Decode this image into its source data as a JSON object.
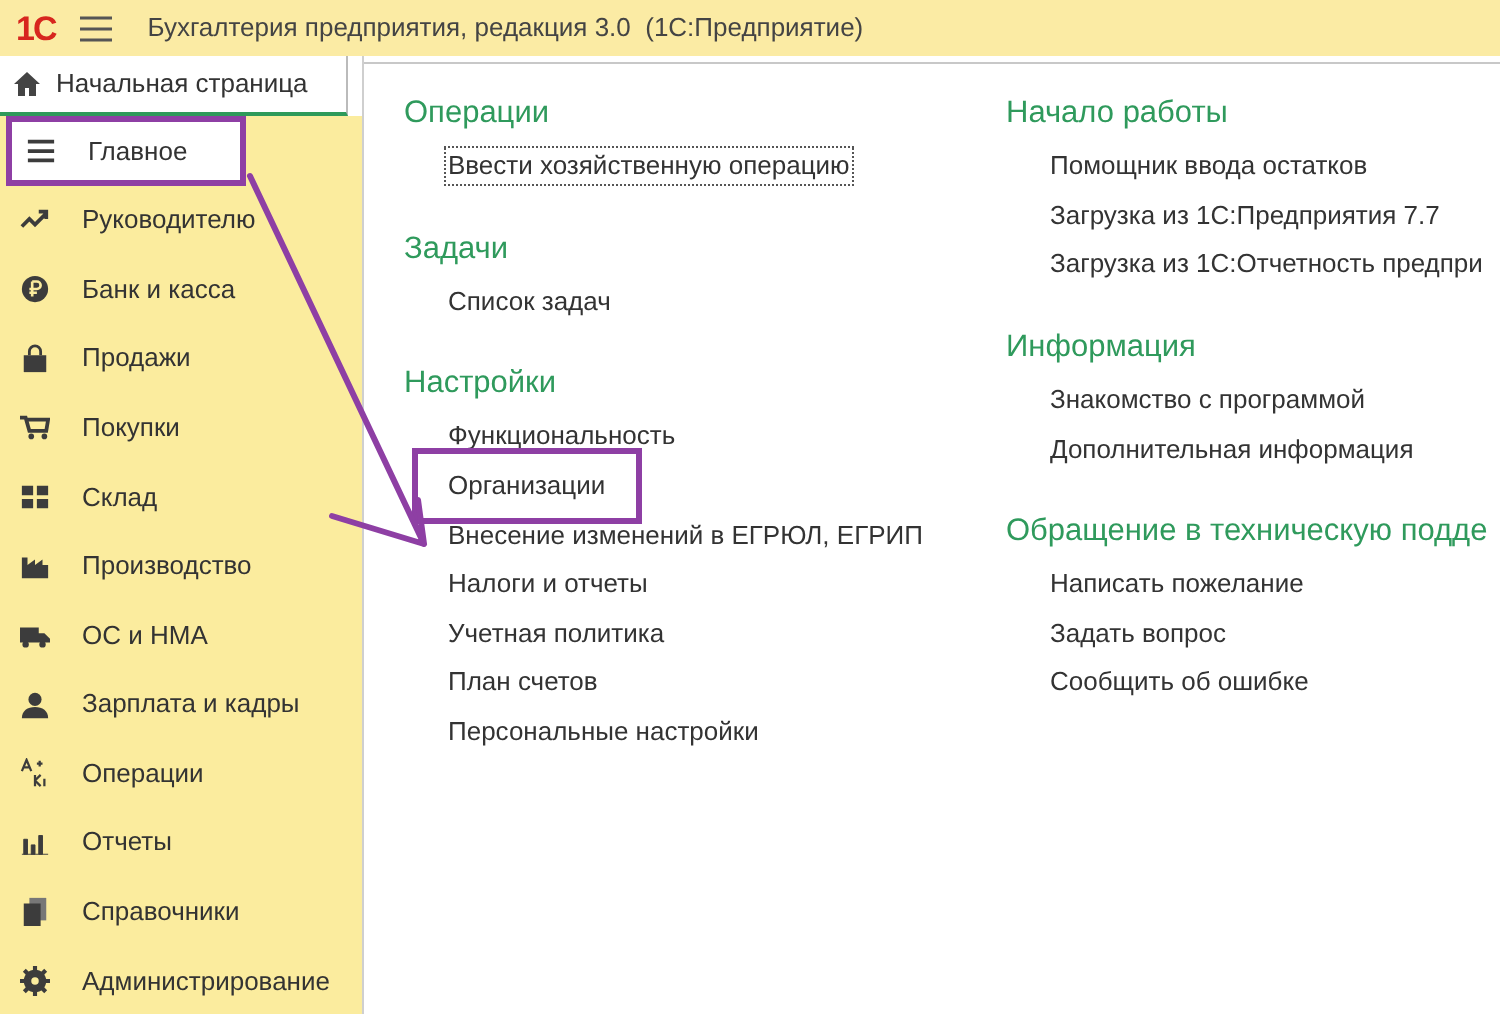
{
  "app": {
    "logo": "1С",
    "title": "Бухгалтерия предприятия, редакция 3.0  (1С:Предприятие)"
  },
  "tab": {
    "label": "Начальная страница",
    "selected": true
  },
  "sidebar": {
    "items": [
      {
        "label": "Главное",
        "selected": true,
        "highlighted": true
      },
      {
        "label": "Руководителю",
        "selected": false,
        "highlighted": false
      },
      {
        "label": "Банк и касса",
        "selected": false,
        "highlighted": false
      },
      {
        "label": "Продажи",
        "selected": false,
        "highlighted": false
      },
      {
        "label": "Покупки",
        "selected": false,
        "highlighted": false
      },
      {
        "label": "Склад",
        "selected": false,
        "highlighted": false
      },
      {
        "label": "Производство",
        "selected": false,
        "highlighted": false
      },
      {
        "label": "ОС и НМА",
        "selected": false,
        "highlighted": false
      },
      {
        "label": "Зарплата и кадры",
        "selected": false,
        "highlighted": false
      },
      {
        "label": "Операции",
        "selected": false,
        "highlighted": false
      },
      {
        "label": "Отчеты",
        "selected": false,
        "highlighted": false
      },
      {
        "label": "Справочники",
        "selected": false,
        "highlighted": false
      },
      {
        "label": "Администрирование",
        "selected": false,
        "highlighted": false
      }
    ]
  },
  "columns": [
    [
      {
        "heading": "Операции",
        "links": [
          {
            "label": "Ввести хозяйственную операцию",
            "focused": true,
            "highlighted": false
          }
        ]
      },
      {
        "heading": "Задачи",
        "links": [
          {
            "label": "Список задач",
            "focused": false,
            "highlighted": false
          }
        ]
      },
      {
        "heading": "Настройки",
        "links": [
          {
            "label": "Функциональность",
            "focused": false,
            "highlighted": false
          },
          {
            "label": "Организации",
            "focused": false,
            "highlighted": true
          },
          {
            "label": "Внесение изменений в ЕГРЮЛ, ЕГРИП",
            "focused": false,
            "highlighted": false
          },
          {
            "label": "Налоги и отчеты",
            "focused": false,
            "highlighted": false
          },
          {
            "label": "Учетная политика",
            "focused": false,
            "highlighted": false
          },
          {
            "label": "План счетов",
            "focused": false,
            "highlighted": false
          },
          {
            "label": "Персональные настройки",
            "focused": false,
            "highlighted": false
          }
        ]
      }
    ],
    [
      {
        "heading": "Начало работы",
        "links": [
          {
            "label": "Помощник ввода остатков",
            "focused": false,
            "highlighted": false
          },
          {
            "label": "Загрузка из 1С:Предприятия 7.7",
            "focused": false,
            "highlighted": false
          },
          {
            "label": "Загрузка из 1С:Отчетность предпри",
            "focused": false,
            "highlighted": false
          }
        ]
      },
      {
        "heading": "Информация",
        "links": [
          {
            "label": "Знакомство с программой",
            "focused": false,
            "highlighted": false
          },
          {
            "label": "Дополнительная информация",
            "focused": false,
            "highlighted": false
          }
        ]
      },
      {
        "heading": "Обращение в техническую подде",
        "links": [
          {
            "label": "Написать пожелание",
            "focused": false,
            "highlighted": false
          },
          {
            "label": "Задать вопрос",
            "focused": false,
            "highlighted": false
          },
          {
            "label": "Сообщить об ошибке",
            "focused": false,
            "highlighted": false
          }
        ]
      }
    ]
  ]
}
